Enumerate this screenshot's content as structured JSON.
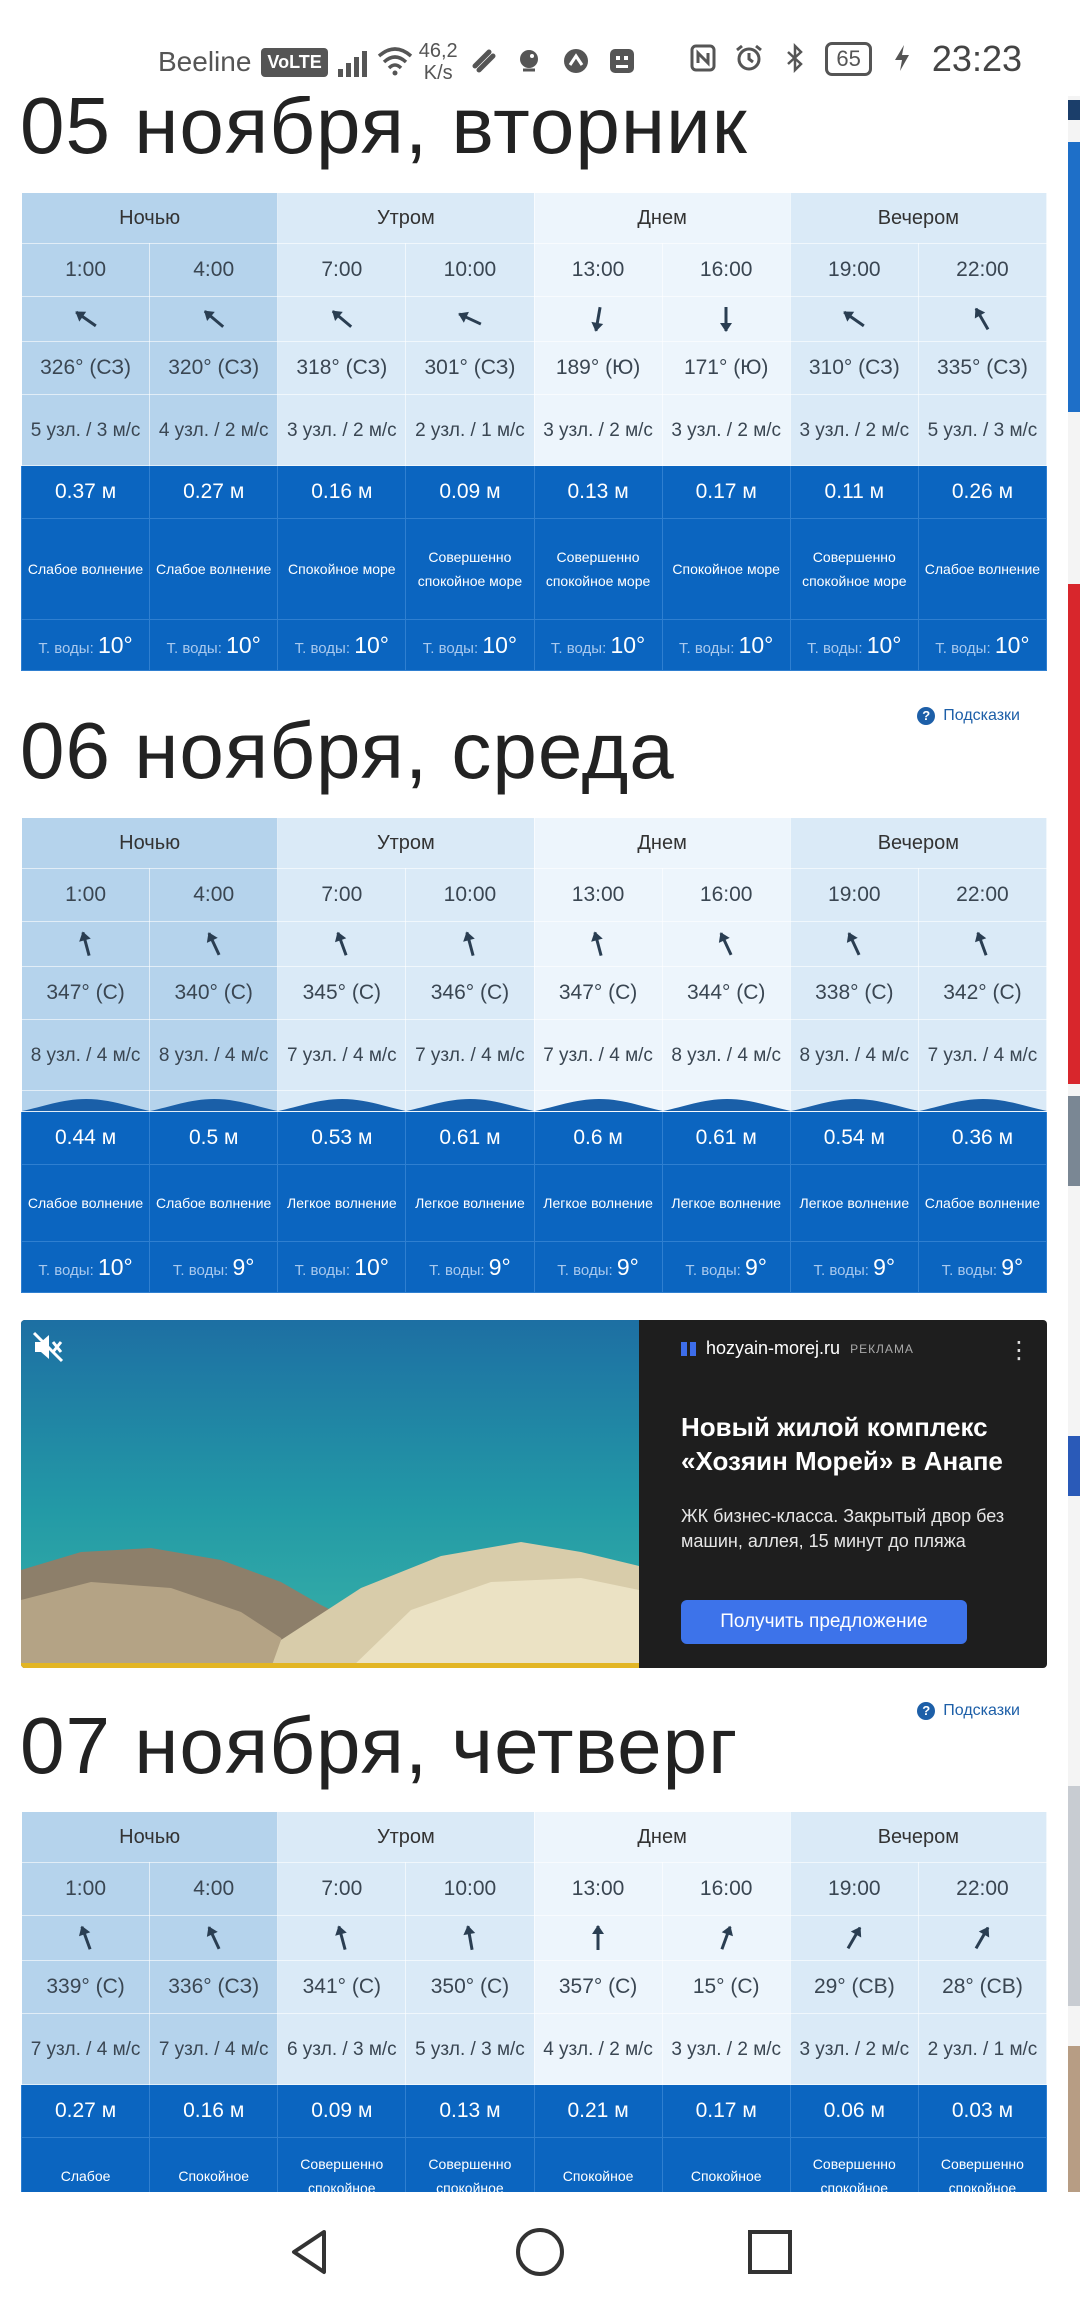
{
  "status_bar": {
    "carrier": "Beeline",
    "volte": "VoLTE",
    "speed_value": "46,2",
    "speed_unit": "K/s",
    "battery": "65",
    "time": "23:23"
  },
  "periods": [
    "Ночью",
    "Утром",
    "Днем",
    "Вечером"
  ],
  "times": [
    "1:00",
    "4:00",
    "7:00",
    "10:00",
    "13:00",
    "16:00",
    "19:00",
    "22:00"
  ],
  "hints_label": "Подсказки",
  "temp_label": "Т. воды:",
  "days": [
    {
      "title": "05 ноября, вторник",
      "dir_rotations": [
        125,
        130,
        130,
        115,
        10,
        0,
        125,
        150
      ],
      "degrees": [
        "326° (СЗ)",
        "320° (СЗ)",
        "318° (СЗ)",
        "301° (СЗ)",
        "189° (Ю)",
        "171° (Ю)",
        "310° (СЗ)",
        "335° (СЗ)"
      ],
      "speeds": [
        "5 узл. / 3 м/с",
        "4 узл. / 2 м/с",
        "3 узл. / 2 м/с",
        "2 узл. / 1 м/с",
        "3 узл. / 2 м/с",
        "3 узл. / 2 м/с",
        "3 узл. / 2 м/с",
        "5 узл. / 3 м/с"
      ],
      "heights": [
        "0.37 м",
        "0.27 м",
        "0.16 м",
        "0.09 м",
        "0.13 м",
        "0.17 м",
        "0.11 м",
        "0.26 м"
      ],
      "descriptions": [
        "Слабое волнение",
        "Слабое волнение",
        "Спокойное море",
        "Совершенно спокойное море",
        "Совершенно спокойное море",
        "Спокойное море",
        "Совершенно спокойное море",
        "Слабое волнение"
      ],
      "water_temps": [
        "10°",
        "10°",
        "10°",
        "10°",
        "10°",
        "10°",
        "10°",
        "10°"
      ]
    },
    {
      "title": "06 ноября, среда",
      "dir_rotations": [
        165,
        155,
        160,
        165,
        165,
        155,
        155,
        160
      ],
      "degrees": [
        "347° (С)",
        "340° (С)",
        "345° (С)",
        "346° (С)",
        "347° (С)",
        "344° (С)",
        "338° (С)",
        "342° (С)"
      ],
      "speeds": [
        "8 узл. / 4 м/с",
        "8 узл. / 4 м/с",
        "7 узл. / 4 м/с",
        "7 узл. / 4 м/с",
        "7 узл. / 4 м/с",
        "8 узл. / 4 м/с",
        "8 узл. / 4 м/с",
        "7 узл. / 4 м/с"
      ],
      "heights": [
        "0.44 м",
        "0.5 м",
        "0.53 м",
        "0.61 м",
        "0.6 м",
        "0.61 м",
        "0.54 м",
        "0.36 м"
      ],
      "descriptions": [
        "Слабое волнение",
        "Слабое волнение",
        "Легкое волнение",
        "Легкое волнение",
        "Легкое волнение",
        "Легкое волнение",
        "Легкое волнение",
        "Слабое волнение"
      ],
      "water_temps": [
        "10°",
        "9°",
        "10°",
        "9°",
        "9°",
        "9°",
        "9°",
        "9°"
      ]
    },
    {
      "title": "07 ноября, четверг",
      "dir_rotations": [
        160,
        155,
        165,
        170,
        180,
        200,
        210,
        210
      ],
      "degrees": [
        "339° (С)",
        "336° (СЗ)",
        "341° (С)",
        "350° (С)",
        "357° (С)",
        "15° (С)",
        "29° (СВ)",
        "28° (СВ)"
      ],
      "speeds": [
        "7 узл. / 4 м/с",
        "7 узл. / 4 м/с",
        "6 узл. / 3 м/с",
        "5 узл. / 3 м/с",
        "4 узл. / 2 м/с",
        "3 узл. / 2 м/с",
        "3 узл. / 2 м/с",
        "2 узл. / 1 м/с"
      ],
      "heights": [
        "0.27 м",
        "0.16 м",
        "0.09 м",
        "0.13 м",
        "0.21 м",
        "0.17 м",
        "0.06 м",
        "0.03 м"
      ],
      "descriptions": [
        "Слабое",
        "Спокойное",
        "Совершенно спокойное",
        "Совершенно спокойное",
        "Спокойное",
        "Спокойное",
        "Совершенно спокойное",
        "Совершенно спокойное"
      ]
    }
  ],
  "ad": {
    "domain": "hozyain-morej.ru",
    "tag": "РЕКЛАМА",
    "title": "Новый жилой комплекс «Хозяин Морей» в Анапе",
    "text": "ЖК бизнес-класса. Закрытый двор без машин, аллея, 15 минут до пляжа",
    "button": "Получить предложение"
  }
}
